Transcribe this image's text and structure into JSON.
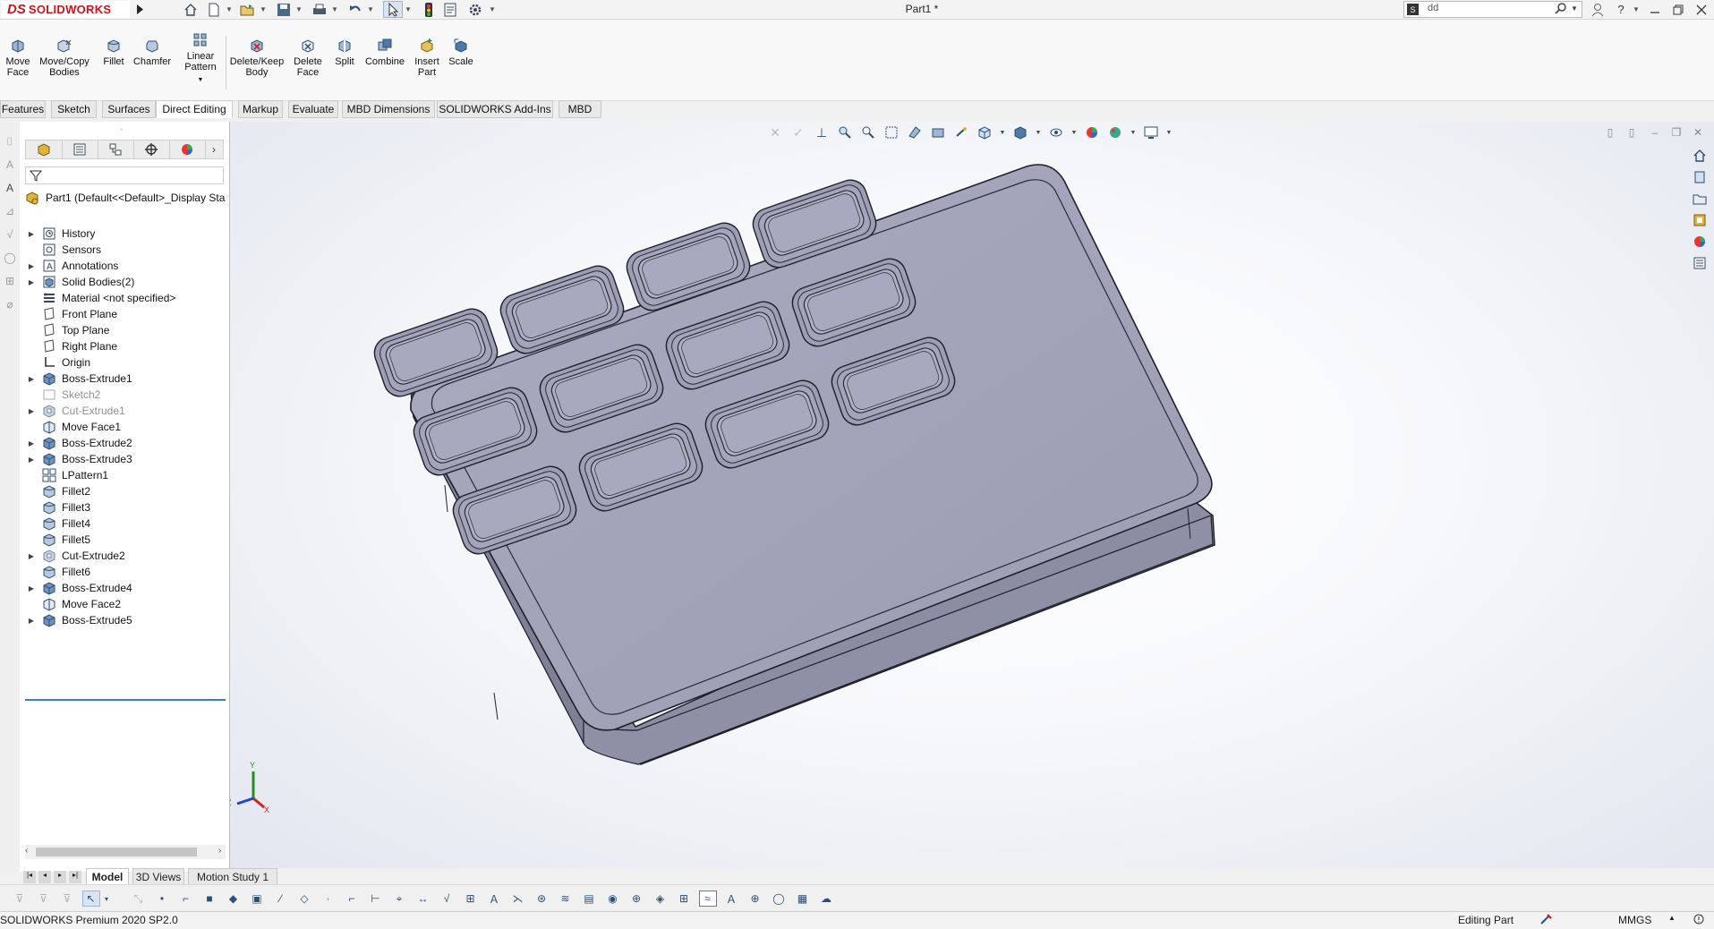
{
  "app": {
    "logo_ds": "DS",
    "logo_name": "SOLIDWORKS",
    "document_title": "Part1 *"
  },
  "search": {
    "value": "dd",
    "placeholder": ""
  },
  "quick_access": [
    "home-icon",
    "new-document-icon",
    "open-icon",
    "save-icon",
    "print-icon",
    "undo-icon",
    "select-icon",
    "rebuild-icon",
    "file-properties-icon",
    "options-icon"
  ],
  "command_manager": {
    "buttons": [
      {
        "label": "Move\nFace",
        "icon": "move-face-icon"
      },
      {
        "label": "Move/Copy\nBodies",
        "icon": "move-copy-bodies-icon"
      },
      {
        "label": "Fillet",
        "icon": "fillet-icon"
      },
      {
        "label": "Chamfer",
        "icon": "chamfer-icon"
      },
      {
        "label": "Linear\nPattern",
        "icon": "linear-pattern-icon"
      },
      {
        "label": "Delete/Keep\nBody",
        "icon": "delete-keep-body-icon"
      },
      {
        "label": "Delete\nFace",
        "icon": "delete-face-icon"
      },
      {
        "label": "Split",
        "icon": "split-icon"
      },
      {
        "label": "Combine",
        "icon": "combine-icon"
      },
      {
        "label": "Insert\nPart",
        "icon": "insert-part-icon"
      },
      {
        "label": "Scale",
        "icon": "scale-icon"
      }
    ]
  },
  "tabs": [
    "Features",
    "Sketch",
    "Surfaces",
    "Direct Editing",
    "Markup",
    "Evaluate",
    "MBD Dimensions",
    "SOLIDWORKS Add-Ins",
    "MBD"
  ],
  "active_tab": "Direct Editing",
  "feature_tree": {
    "root": "Part1  (Default<<Default>_Display Sta",
    "items": [
      {
        "label": "History",
        "expandable": true,
        "icon": "history-icon",
        "dim": false
      },
      {
        "label": "Sensors",
        "expandable": false,
        "icon": "sensors-icon",
        "dim": false
      },
      {
        "label": "Annotations",
        "expandable": true,
        "icon": "annotations-icon",
        "dim": false
      },
      {
        "label": "Solid Bodies(2)",
        "expandable": true,
        "icon": "solid-bodies-icon",
        "dim": false
      },
      {
        "label": "Material <not specified>",
        "expandable": false,
        "icon": "material-icon",
        "dim": false
      },
      {
        "label": "Front Plane",
        "expandable": false,
        "icon": "plane-icon",
        "dim": false
      },
      {
        "label": "Top Plane",
        "expandable": false,
        "icon": "plane-icon",
        "dim": false
      },
      {
        "label": "Right Plane",
        "expandable": false,
        "icon": "plane-icon",
        "dim": false
      },
      {
        "label": "Origin",
        "expandable": false,
        "icon": "origin-icon",
        "dim": false
      },
      {
        "label": "Boss-Extrude1",
        "expandable": true,
        "icon": "boss-extrude-icon",
        "dim": false
      },
      {
        "label": "Sketch2",
        "expandable": false,
        "icon": "sketch-icon",
        "dim": true
      },
      {
        "label": "Cut-Extrude1",
        "expandable": true,
        "icon": "cut-extrude-icon",
        "dim": true
      },
      {
        "label": "Move Face1",
        "expandable": false,
        "icon": "move-face-icon",
        "dim": false
      },
      {
        "label": "Boss-Extrude2",
        "expandable": true,
        "icon": "boss-extrude-icon",
        "dim": false
      },
      {
        "label": "Boss-Extrude3",
        "expandable": true,
        "icon": "boss-extrude-icon",
        "dim": false
      },
      {
        "label": "LPattern1",
        "expandable": false,
        "icon": "linear-pattern-icon",
        "dim": false
      },
      {
        "label": "Fillet2",
        "expandable": false,
        "icon": "fillet-icon",
        "dim": false
      },
      {
        "label": "Fillet3",
        "expandable": false,
        "icon": "fillet-icon",
        "dim": false
      },
      {
        "label": "Fillet4",
        "expandable": false,
        "icon": "fillet-icon",
        "dim": false
      },
      {
        "label": "Fillet5",
        "expandable": false,
        "icon": "fillet-icon",
        "dim": false
      },
      {
        "label": "Cut-Extrude2",
        "expandable": true,
        "icon": "cut-extrude-icon",
        "dim": false
      },
      {
        "label": "Fillet6",
        "expandable": false,
        "icon": "fillet-icon",
        "dim": false
      },
      {
        "label": "Boss-Extrude4",
        "expandable": true,
        "icon": "boss-extrude-icon",
        "dim": false
      },
      {
        "label": "Move Face2",
        "expandable": false,
        "icon": "move-face-icon",
        "dim": false
      },
      {
        "label": "Boss-Extrude5",
        "expandable": true,
        "icon": "boss-extrude-icon",
        "dim": false
      }
    ]
  },
  "model_tabs": [
    "Model",
    "3D Views",
    "Motion Study 1"
  ],
  "active_model_tab": "Model",
  "status": {
    "product": "SOLIDWORKS Premium 2020 SP2.0",
    "mode": "Editing Part",
    "units": "MMGS"
  },
  "triad": {
    "x": "X",
    "y": "Y",
    "z": "Z"
  },
  "colors": {
    "brand_red": "#d0121b",
    "model_body": "#a6a8bc",
    "selection_blue": "#3a7bd5"
  }
}
